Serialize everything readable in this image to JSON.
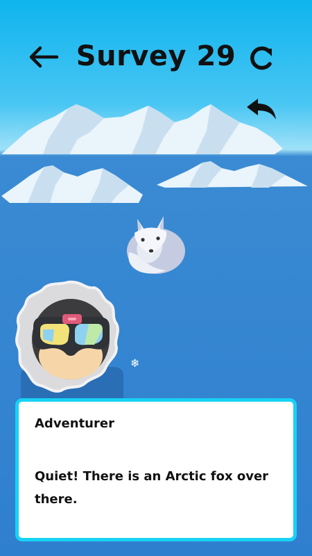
{
  "header": {
    "title": "Survey 29"
  },
  "dialog": {
    "speaker": "Adventurer",
    "message": "Quiet! There is an Arctic fox over there."
  },
  "icons": {
    "back": "arrow-left-icon",
    "restart": "restart-icon",
    "undo": "undo-icon",
    "snowflake": "❄"
  },
  "colors": {
    "sky": "#0fb4ee",
    "sea": "#2f7fcf",
    "dialog_border": "#17d2f5",
    "ice": "#e9f4fb"
  }
}
